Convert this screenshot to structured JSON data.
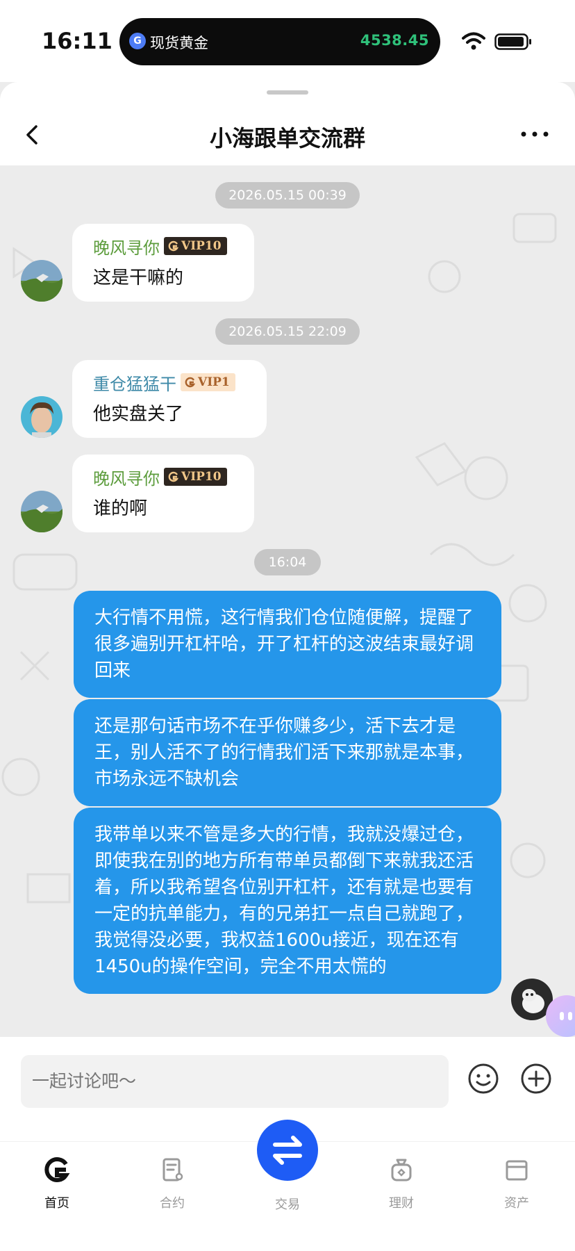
{
  "status_bar": {
    "time": "16:11",
    "island_label": "现货黄金",
    "island_value": "4538.45"
  },
  "header": {
    "title": "小海跟单交流群"
  },
  "messages": [
    {
      "type": "timestamp",
      "text": "2026.05.15 00:39"
    },
    {
      "type": "incoming",
      "sender": "晚风寻你",
      "vip": "VIP10",
      "text": "这是干嘛的"
    },
    {
      "type": "timestamp",
      "text": "2026.05.15 22:09"
    },
    {
      "type": "incoming",
      "sender": "重仓猛猛干",
      "vip": "VIP1",
      "text": "他实盘关了"
    },
    {
      "type": "incoming",
      "sender": "晚风寻你",
      "vip": "VIP10",
      "text": "谁的啊"
    },
    {
      "type": "timestamp",
      "text": "16:04"
    },
    {
      "type": "outgoing",
      "text": "大行情不用慌，这行情我们仓位随便解，提醒了很多遍别开杠杆哈，开了杠杆的这波结束最好调回来"
    },
    {
      "type": "outgoing",
      "text": "还是那句话市场不在乎你赚多少，活下去才是王，别人活不了的行情我们活下来那就是本事，市场永远不缺机会"
    },
    {
      "type": "outgoing",
      "text": "我带单以来不管是多大的行情，我就没爆过仓，即使我在别的地方所有带单员都倒下来就我还活着，所以我希望各位别开杠杆，还有就是也要有一定的抗单能力，有的兄弟扛一点自己就跑了，我觉得没必要，我权益1600u接近，现在还有1450u的操作空间，完全不用太慌的"
    }
  ],
  "input": {
    "placeholder": "一起讨论吧～"
  },
  "tabs": [
    {
      "label": "首页",
      "icon": "home-logo-icon",
      "active": true
    },
    {
      "label": "合约",
      "icon": "contract-icon",
      "active": false
    },
    {
      "label": "交易",
      "icon": "swap-icon",
      "active": false
    },
    {
      "label": "理财",
      "icon": "wealth-bag-icon",
      "active": false
    },
    {
      "label": "资产",
      "icon": "wallet-icon",
      "active": false
    }
  ],
  "colors": {
    "outgoing_bubble": "#2596ea",
    "sender_green": "#5c9c3c",
    "sender_teal": "#3f8aa8",
    "trade_button": "#1e5cf5",
    "island_value": "#2fc17a"
  }
}
